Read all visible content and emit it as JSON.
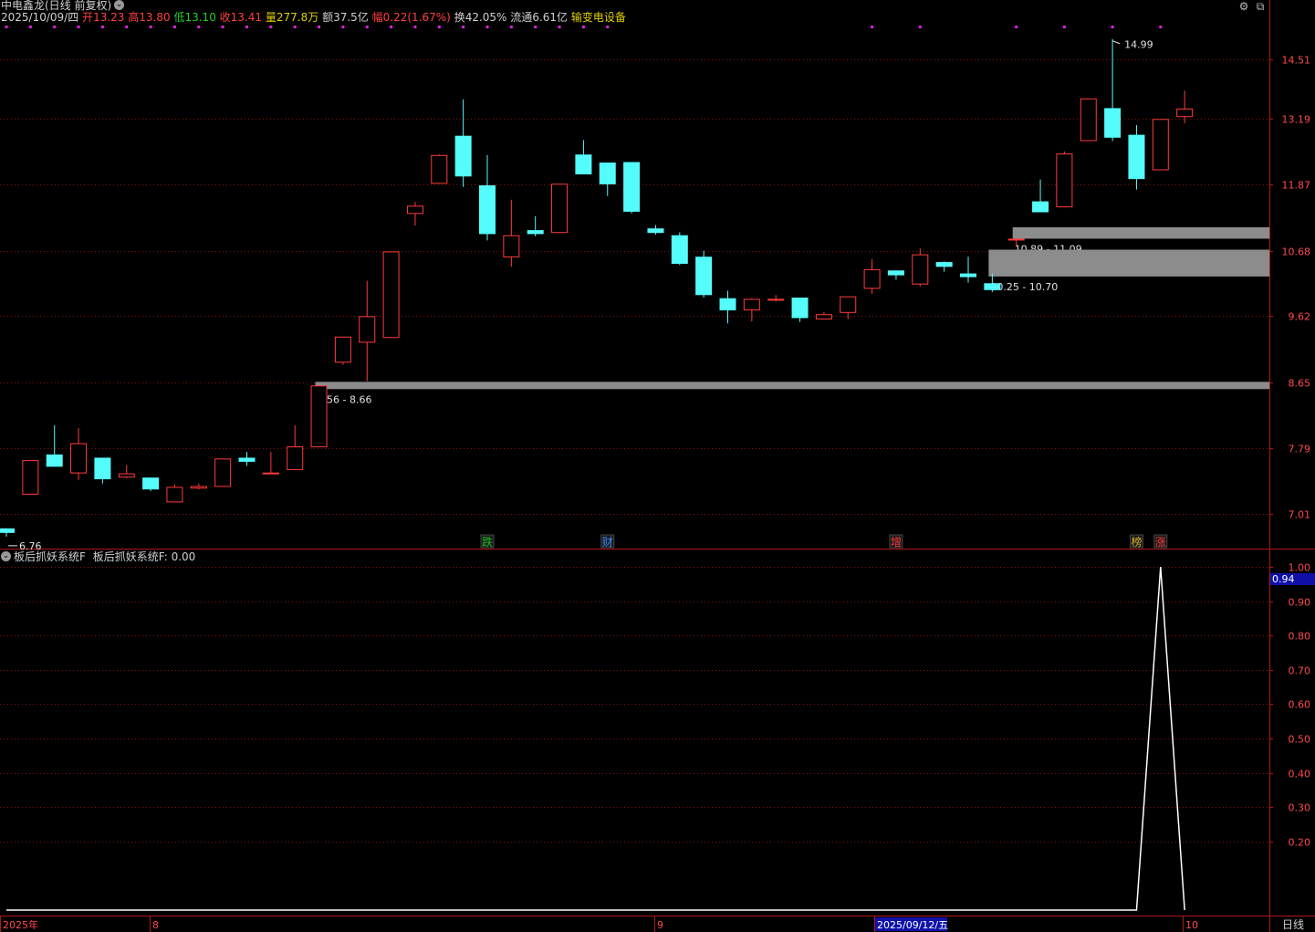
{
  "header": {
    "title": "中电鑫龙(日线 前复权)",
    "date": "2025/10/09/四",
    "open_label": "开",
    "open": "13.23",
    "high_label": "高",
    "high": "13.80",
    "low_label": "低",
    "low": "13.10",
    "close_label": "收",
    "close": "13.41",
    "vol_label": "量",
    "vol": "277.8万",
    "amt_label": "额",
    "amt": "37.5亿",
    "chg_label": "幅",
    "chg": "0.22(1.67%)",
    "turn_label": "换",
    "turn": "42.05%",
    "float_label": "流通",
    "float": "6.61亿",
    "sector": "输变电设备"
  },
  "indicator": {
    "title": "板后抓妖系统F",
    "value_text": "板后抓妖系统F: 0.00",
    "current_value": "0.94"
  },
  "period_label": "日线",
  "colors": {
    "up": "#ff3b3b",
    "down": "#54fcfc",
    "grid": "#8a1010",
    "axis_text": "#ff4a4a",
    "band": "#8c8c8c",
    "signal_mark": "#e020e0"
  },
  "chart_data": [
    {
      "type": "candlestick",
      "ylim": [
        6.55,
        15.2
      ],
      "y_ticks": [
        7.01,
        7.79,
        8.65,
        9.62,
        10.68,
        11.87,
        13.19,
        14.51
      ],
      "x_labels": [
        "2025年",
        "8",
        "9",
        "2025/09/12/五",
        "10"
      ],
      "candles": [
        {
          "o": 6.85,
          "h": 6.85,
          "l": 6.76,
          "c": 6.8
        },
        {
          "o": 7.23,
          "h": 7.64,
          "l": 7.23,
          "c": 7.64
        },
        {
          "o": 7.71,
          "h": 8.08,
          "l": 7.56,
          "c": 7.56
        },
        {
          "o": 7.48,
          "h": 8.04,
          "l": 7.4,
          "c": 7.85
        },
        {
          "o": 7.67,
          "h": 7.67,
          "l": 7.36,
          "c": 7.41
        },
        {
          "o": 7.43,
          "h": 7.58,
          "l": 7.42,
          "c": 7.48
        },
        {
          "o": 7.43,
          "h": 7.43,
          "l": 7.27,
          "c": 7.29
        },
        {
          "o": 7.14,
          "h": 7.35,
          "l": 7.14,
          "c": 7.32
        },
        {
          "o": 7.3,
          "h": 7.36,
          "l": 7.29,
          "c": 7.33
        },
        {
          "o": 7.32,
          "h": 7.66,
          "l": 7.32,
          "c": 7.66
        },
        {
          "o": 7.67,
          "h": 7.74,
          "l": 7.57,
          "c": 7.62
        },
        {
          "o": 7.49,
          "h": 7.74,
          "l": 7.47,
          "c": 7.49
        },
        {
          "o": 7.52,
          "h": 8.08,
          "l": 7.52,
          "c": 7.81
        },
        {
          "o": 7.8,
          "h": 8.61,
          "l": 7.8,
          "c": 8.61
        },
        {
          "o": 8.93,
          "h": 9.31,
          "l": 8.9,
          "c": 9.31
        },
        {
          "o": 9.22,
          "h": 10.18,
          "l": 8.67,
          "c": 9.62
        },
        {
          "o": 9.29,
          "h": 10.67,
          "l": 9.29,
          "c": 10.67
        },
        {
          "o": 11.33,
          "h": 11.55,
          "l": 11.12,
          "c": 11.48
        },
        {
          "o": 11.89,
          "h": 12.46,
          "l": 11.89,
          "c": 12.45
        },
        {
          "o": 12.84,
          "h": 13.61,
          "l": 11.83,
          "c": 12.03
        },
        {
          "o": 11.86,
          "h": 12.45,
          "l": 10.86,
          "c": 10.97
        },
        {
          "o": 10.57,
          "h": 11.59,
          "l": 10.41,
          "c": 10.95
        },
        {
          "o": 11.04,
          "h": 11.29,
          "l": 10.93,
          "c": 10.97
        },
        {
          "o": 10.99,
          "h": 11.89,
          "l": 10.99,
          "c": 11.89
        },
        {
          "o": 12.46,
          "h": 12.75,
          "l": 12.07,
          "c": 12.07
        },
        {
          "o": 12.3,
          "h": 12.3,
          "l": 11.66,
          "c": 11.88
        },
        {
          "o": 12.31,
          "h": 12.31,
          "l": 11.34,
          "c": 11.37
        },
        {
          "o": 11.07,
          "h": 11.13,
          "l": 10.96,
          "c": 10.99
        },
        {
          "o": 10.95,
          "h": 11.0,
          "l": 10.44,
          "c": 10.46
        },
        {
          "o": 10.58,
          "h": 10.68,
          "l": 9.91,
          "c": 9.95
        },
        {
          "o": 9.9,
          "h": 10.02,
          "l": 9.51,
          "c": 9.71
        },
        {
          "o": 9.71,
          "h": 9.9,
          "l": 9.54,
          "c": 9.89
        },
        {
          "o": 9.89,
          "h": 9.95,
          "l": 9.85,
          "c": 9.89
        },
        {
          "o": 9.91,
          "h": 9.91,
          "l": 9.53,
          "c": 9.59
        },
        {
          "o": 9.57,
          "h": 9.68,
          "l": 9.57,
          "c": 9.65
        },
        {
          "o": 9.67,
          "h": 9.93,
          "l": 9.57,
          "c": 9.93
        },
        {
          "o": 10.05,
          "h": 10.54,
          "l": 9.97,
          "c": 10.37
        },
        {
          "o": 10.35,
          "h": 10.35,
          "l": 10.2,
          "c": 10.27
        },
        {
          "o": 10.12,
          "h": 10.72,
          "l": 10.09,
          "c": 10.62
        },
        {
          "o": 10.49,
          "h": 10.5,
          "l": 10.33,
          "c": 10.41
        },
        {
          "o": 10.3,
          "h": 10.58,
          "l": 10.15,
          "c": 10.24
        },
        {
          "o": 10.14,
          "h": 10.3,
          "l": 10.0,
          "c": 10.03
        },
        {
          "o": 10.89,
          "h": 10.89,
          "l": 10.75,
          "c": 10.89
        },
        {
          "o": 11.56,
          "h": 11.97,
          "l": 11.38,
          "c": 11.36
        },
        {
          "o": 11.45,
          "h": 12.52,
          "l": 11.45,
          "c": 12.48
        },
        {
          "o": 12.73,
          "h": 13.63,
          "l": 12.73,
          "c": 13.63
        },
        {
          "o": 13.42,
          "h": 14.99,
          "l": 12.73,
          "c": 12.8
        },
        {
          "o": 12.86,
          "h": 13.06,
          "l": 11.78,
          "c": 11.98
        },
        {
          "o": 12.15,
          "h": 13.19,
          "l": 12.15,
          "c": 13.19
        },
        {
          "o": 13.23,
          "h": 13.8,
          "l": 13.1,
          "c": 13.41
        }
      ],
      "bands": [
        {
          "low": 8.56,
          "high": 8.66,
          "label": "8.56 - 8.66",
          "start_index": 13
        },
        {
          "low": 10.89,
          "high": 11.09,
          "label": "10.89 - 11.09",
          "start_index": 42
        },
        {
          "low": 10.25,
          "high": 10.7,
          "label": "10.25 - 10.70",
          "start_index": 41
        }
      ],
      "annotations": [
        {
          "index": 0,
          "text": "6.76",
          "kind": "low"
        },
        {
          "index": 46,
          "text": "14.99",
          "kind": "high"
        }
      ],
      "event_tags": [
        {
          "index": 20,
          "text": "跌",
          "color": "#17c21c"
        },
        {
          "index": 25,
          "text": "财",
          "color": "#3c8cff"
        },
        {
          "index": 37,
          "text": "增",
          "color": "#ff3b3b"
        },
        {
          "index": 47,
          "text": "榜",
          "color": "#d6b030"
        },
        {
          "index": 48,
          "text": "涨",
          "color": "#ff3b3b"
        }
      ],
      "signal_marks": [
        0,
        1,
        2,
        3,
        4,
        5,
        6,
        7,
        8,
        9,
        10,
        11,
        12,
        13,
        14,
        15,
        16,
        17,
        18,
        19,
        20,
        21,
        22,
        23,
        24,
        25,
        36,
        38,
        42,
        44,
        46,
        48
      ]
    },
    {
      "type": "line",
      "ylim": [
        0,
        1.0
      ],
      "y_ticks": [
        0.2,
        0.3,
        0.4,
        0.5,
        0.6,
        0.7,
        0.8,
        0.9,
        1.0
      ],
      "series": [
        {
          "values": [
            0,
            0,
            0,
            0,
            0,
            0,
            0,
            0,
            0,
            0,
            0,
            0,
            0,
            0,
            0,
            0,
            0,
            0,
            0,
            0,
            0,
            0,
            0,
            0,
            0,
            0,
            0,
            0,
            0,
            0,
            0,
            0,
            0,
            0,
            0,
            0,
            0,
            0,
            0,
            0,
            0,
            0,
            0,
            0,
            0,
            0,
            0,
            0,
            1.0,
            0
          ]
        }
      ]
    }
  ]
}
